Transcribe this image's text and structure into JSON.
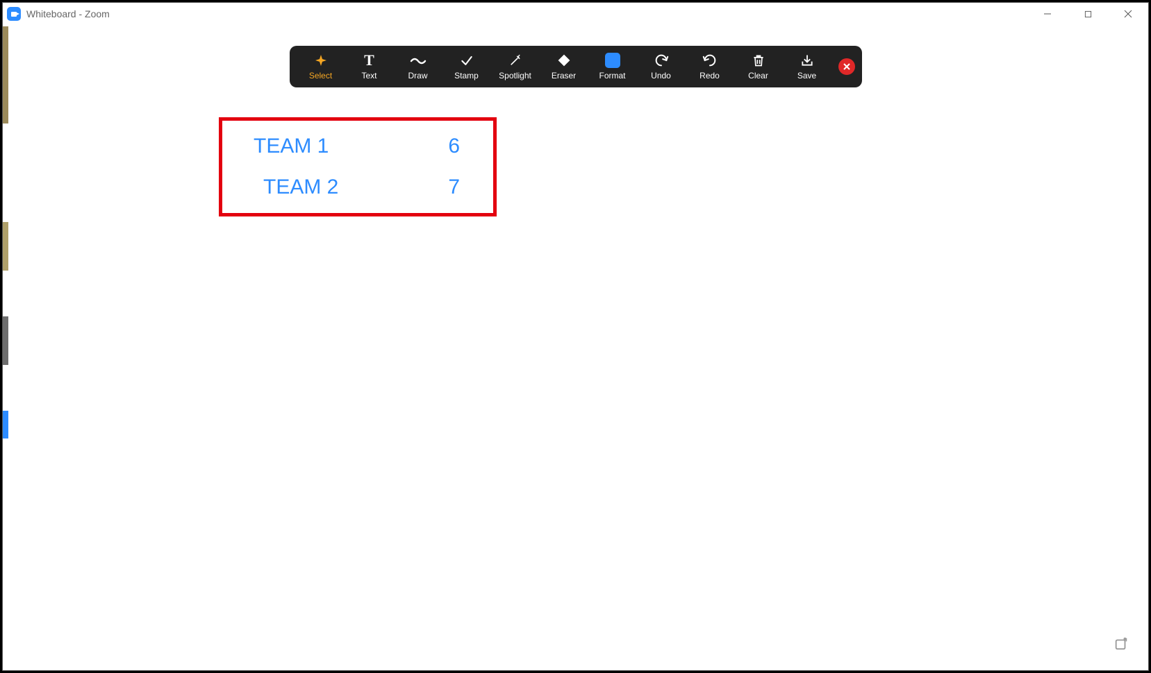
{
  "window": {
    "title": "Whiteboard - Zoom"
  },
  "toolbar": {
    "items": [
      {
        "label": "Select"
      },
      {
        "label": "Text"
      },
      {
        "label": "Draw"
      },
      {
        "label": "Stamp"
      },
      {
        "label": "Spotlight"
      },
      {
        "label": "Eraser"
      },
      {
        "label": "Format"
      },
      {
        "label": "Undo"
      },
      {
        "label": "Redo"
      },
      {
        "label": "Clear"
      },
      {
        "label": "Save"
      }
    ]
  },
  "whiteboard": {
    "scores": [
      {
        "team": "TEAM 1",
        "value": "6"
      },
      {
        "team": "TEAM 2",
        "value": "7"
      }
    ]
  }
}
